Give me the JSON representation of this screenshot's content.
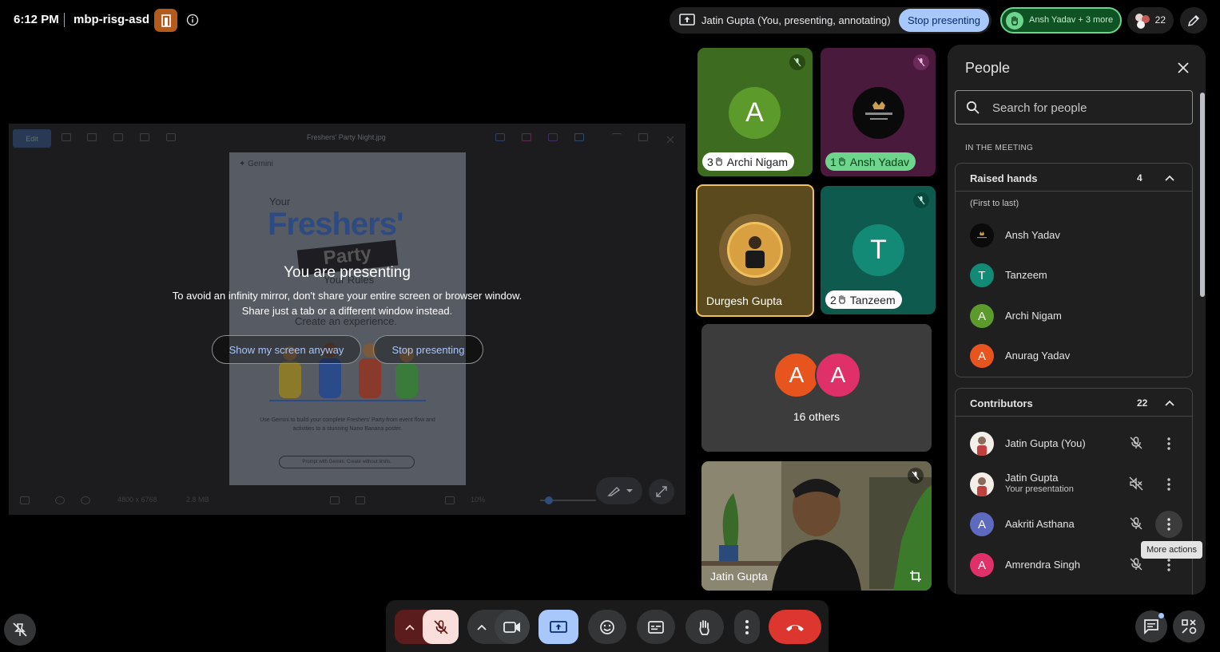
{
  "topbar": {
    "time": "6:12 PM",
    "meeting_code": "mbp-risg-asd",
    "presenting_status": "Jatin Gupta (You, presenting, annotating)",
    "stop_presenting_label": "Stop presenting",
    "raised_hands_summary": "Ansh Yadav + 3 more",
    "participant_count": "22"
  },
  "presentation": {
    "file_name": "Freshers' Party Night.jpg",
    "edit_label": "Edit",
    "image_info": "4800 x 6768",
    "image_size": "2.8 MB",
    "zoom": "10%",
    "poster": {
      "brand": "✦ Gemini",
      "your": "Your",
      "freshers": "Freshers'",
      "party": "Party",
      "tagline": "Your Rules",
      "create": "Create an experience.",
      "description": "Use Gemini to build your complete Freshers' Party-from event flow and activities to a stunning Nano Banana poster.",
      "cta": "Prompt with Gemini. Create without limits."
    },
    "overlay_title": "You are presenting",
    "overlay_line1": "To avoid an infinity mirror, don't share your entire screen or browser window.",
    "overlay_line2": "Share just a tab or a different window instead.",
    "show_anyway_label": "Show my screen anyway",
    "stop_presenting_label": "Stop presenting"
  },
  "tiles": [
    {
      "name": "Archi Nigam",
      "initial": "A",
      "hand_order": "3"
    },
    {
      "name": "Ansh Yadav",
      "hand_order": "1"
    },
    {
      "name": "Durgesh Gupta"
    },
    {
      "name": "Tanzeem",
      "initial": "T",
      "hand_order": "2"
    },
    {
      "others_label": "16 others",
      "initials": [
        "A",
        "A"
      ]
    },
    {
      "name": "Jatin Gupta"
    }
  ],
  "people_panel": {
    "title": "People",
    "search_placeholder": "Search for people",
    "section_label": "IN THE MEETING",
    "raised_hands": {
      "title": "Raised hands",
      "count": "4",
      "order_note": "(First to last)",
      "people": [
        {
          "name": "Ansh Yadav"
        },
        {
          "name": "Tanzeem",
          "initial": "T"
        },
        {
          "name": "Archi Nigam",
          "initial": "A"
        },
        {
          "name": "Anurag Yadav",
          "initial": "A"
        }
      ]
    },
    "contributors": {
      "title": "Contributors",
      "count": "22",
      "people": [
        {
          "name": "Jatin Gupta (You)"
        },
        {
          "name": "Jatin Gupta",
          "subtitle": "Your presentation"
        },
        {
          "name": "Aakriti Asthana",
          "initial": "A"
        },
        {
          "name": "Amrendra Singh",
          "initial": "A"
        }
      ]
    },
    "tooltip": "More actions"
  },
  "colors": {
    "accent_blue": "#a8c7fa",
    "hangup_red": "#dc362e",
    "hand_green": "#6dd58c",
    "panel_bg": "#1f1f1f",
    "tile_archi": "#3d6b1f",
    "tile_ansh": "#4a1a3c",
    "tile_durgesh": "#5a4a1e",
    "tile_tanzeem": "#0f5a4e"
  }
}
